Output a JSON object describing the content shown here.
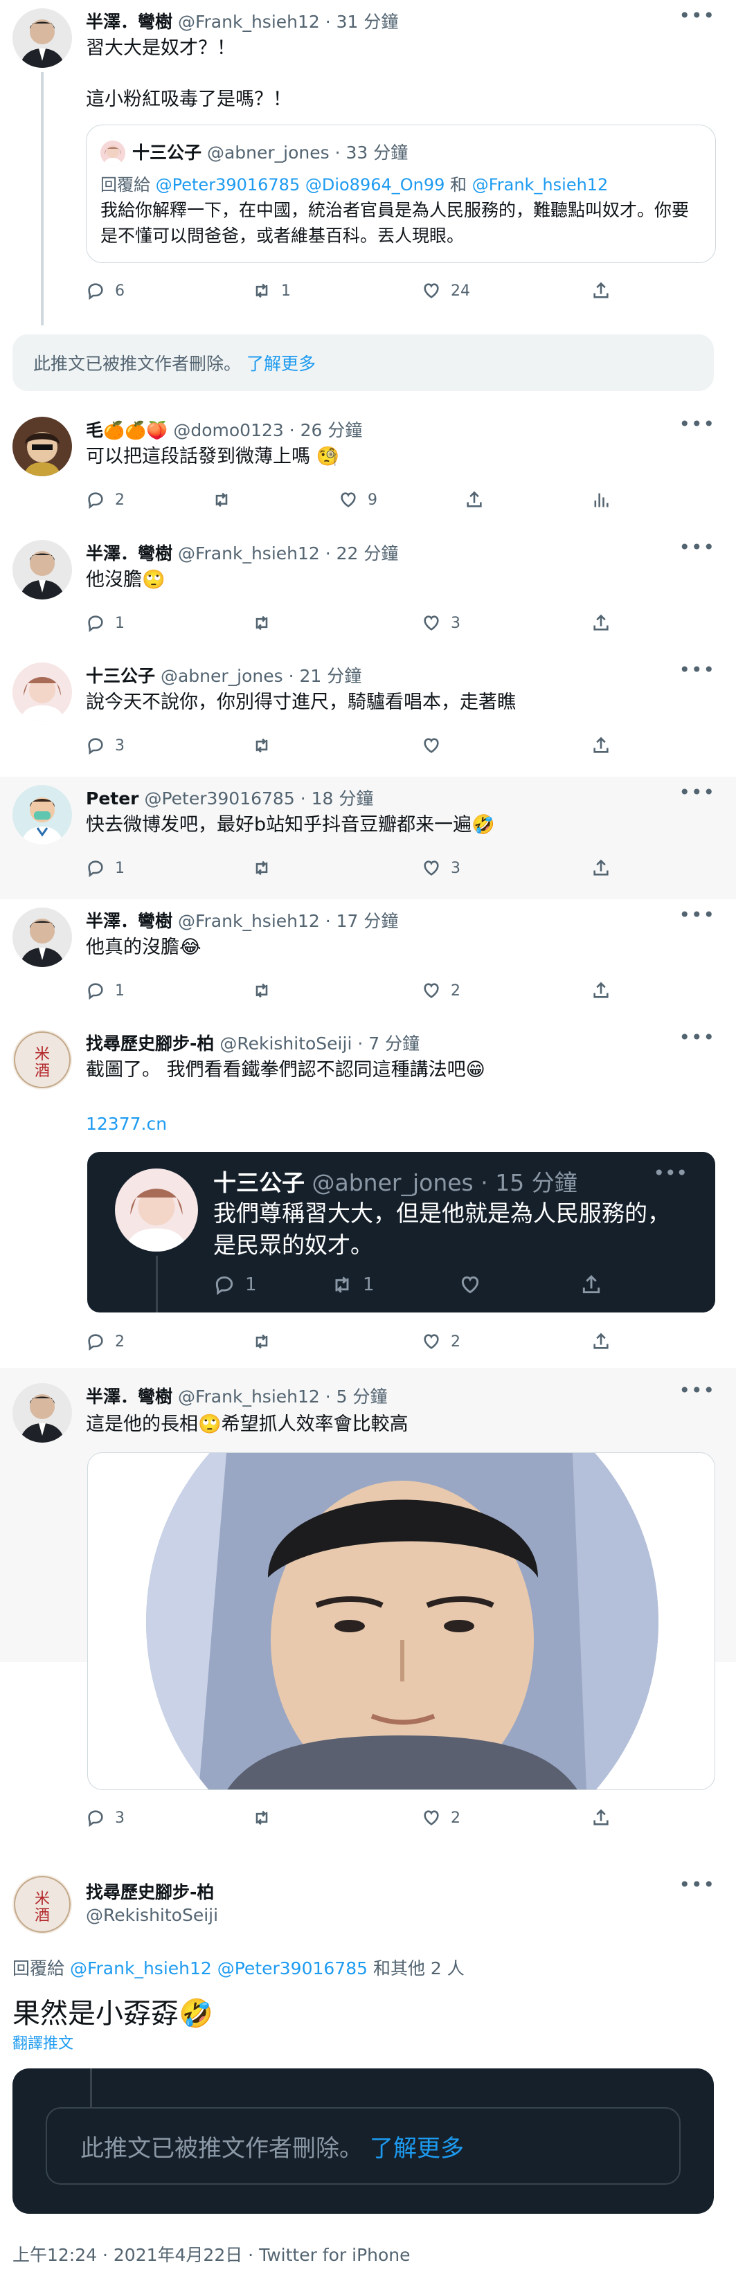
{
  "tweets": [
    {
      "name": "半澤．彎樹",
      "handle": "@Frank_hsieh12",
      "time": "31 分鐘",
      "line1": "習大大是奴才？！",
      "line2": "這小粉紅吸毒了是嗎？！",
      "reply": "6",
      "retweet": "1",
      "like": "24",
      "quote": {
        "name": "十三公子",
        "handle": "@abner_jones",
        "time": "33 分鐘",
        "replying_prefix": "回覆給",
        "replying_to": "@Peter39016785 @Dio8964_On99",
        "replying_and": "和",
        "replying_last": "@Frank_hsieh12",
        "text": "我給你解釋一下，在中國，統治者官員是為人民服務的，難聽點叫奴才。你要是不懂可以問爸爸，或者維基百科。丟人現眼。"
      }
    },
    {
      "name": "毛🍊🍊🍑",
      "handle": "@domo0123",
      "time": "26 分鐘",
      "text": "可以把這段話發到微薄上嗎 🧐",
      "reply": "2",
      "retweet": "",
      "like": "9"
    },
    {
      "name": "半澤．彎樹",
      "handle": "@Frank_hsieh12",
      "time": "22 分鐘",
      "text": "他沒膽🙄",
      "reply": "1",
      "retweet": "",
      "like": "3"
    },
    {
      "name": "十三公子",
      "handle": "@abner_jones",
      "time": "21 分鐘",
      "text": "說今天不說你，你別得寸進尺，騎驢看唱本，走著瞧",
      "reply": "3",
      "retweet": "",
      "like": ""
    },
    {
      "name": "Peter",
      "handle": "@Peter39016785",
      "time": "18 分鐘",
      "text": "快去微博发吧，最好b站知乎抖音豆瓣都来一遍🤣",
      "reply": "1",
      "retweet": "",
      "like": "3"
    },
    {
      "name": "半澤．彎樹",
      "handle": "@Frank_hsieh12",
      "time": "17 分鐘",
      "text": "他真的沒膽😂",
      "reply": "1",
      "retweet": "",
      "like": "2"
    },
    {
      "name": "找尋歷史腳步-柏",
      "handle": "@RekishitoSeiji",
      "time": "7 分鐘",
      "text": "截圖了。 我們看看鐵拳們認不認同這種講法吧😁",
      "link": "12377.cn",
      "reply": "2",
      "retweet": "",
      "like": "2",
      "embed": {
        "name": "十三公子",
        "handle": "@abner_jones",
        "time": "15 分鐘",
        "text": "我們尊稱習大大，但是他就是為人民服務的，是民眾的奴才。",
        "reply": "1",
        "retweet": "1"
      }
    },
    {
      "name": "半澤．彎樹",
      "handle": "@Frank_hsieh12",
      "time": "5 分鐘",
      "text": "這是他的長相🙄希望抓人效率會比較高",
      "reply": "3",
      "retweet": "",
      "like": "2"
    }
  ],
  "notice1": {
    "text": "此推文已被推文作者刪除。",
    "link": "了解更多"
  },
  "main": {
    "name": "找尋歷史腳步-柏",
    "handle": "@RekishitoSeiji",
    "replying_prefix": "回覆給",
    "replying_to": "@Frank_hsieh12 @Peter39016785",
    "replying_others": "和其他 2 人",
    "text": "果然是小孬孬🤣",
    "translate": "翻譯推文"
  },
  "notice2": {
    "text": "此推文已被推文作者刪除。",
    "link": "了解更多"
  },
  "footer": {
    "meta": "上午12:24 · 2021年4月22日 · Twitter for iPhone"
  },
  "colors": {
    "accent": "#1d9bf0",
    "dark_bg": "#15202b"
  }
}
